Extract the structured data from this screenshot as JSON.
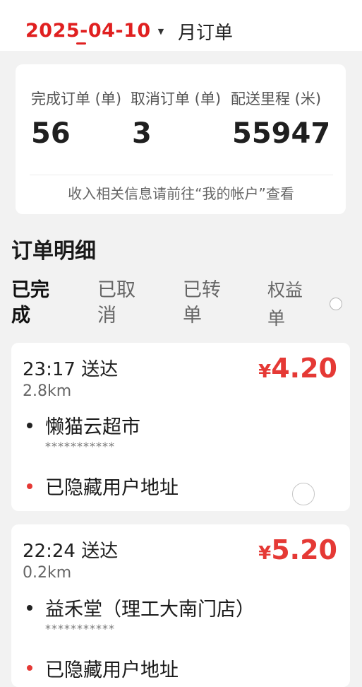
{
  "header": {
    "date": "2025-04-10",
    "month_tab": "月订单"
  },
  "summary": {
    "completed_label": "完成订单 (单)",
    "completed_value": "56",
    "cancelled_label": "取消订单 (单)",
    "cancelled_value": "3",
    "distance_label": "配送里程 (米)",
    "distance_value": "55947",
    "income_note": "收入相关信息请前往“我的帐户”查看"
  },
  "details": {
    "title": "订单明细",
    "tabs": [
      {
        "line1": "已完",
        "line2": "成",
        "active": true
      },
      {
        "line1": "已取",
        "line2": "消",
        "active": false
      },
      {
        "line1": "已转",
        "line2": "单",
        "active": false
      },
      {
        "line1": "权益",
        "line2": "单",
        "active": false
      }
    ]
  },
  "orders": [
    {
      "time": "23:17 送达",
      "distance": "2.8km",
      "currency": "¥",
      "price": "4.20",
      "store": "懒猫云超市",
      "masked": "***********",
      "address": "已隐藏用户地址"
    },
    {
      "time": "22:24 送达",
      "distance": "0.2km",
      "currency": "¥",
      "price": "5.20",
      "store": "益禾堂（理工大南门店）",
      "masked": "***********",
      "address": "已隐藏用户地址"
    }
  ],
  "colors": {
    "accent": "#e02020",
    "price": "#e53935",
    "background": "#f2f2f2"
  }
}
